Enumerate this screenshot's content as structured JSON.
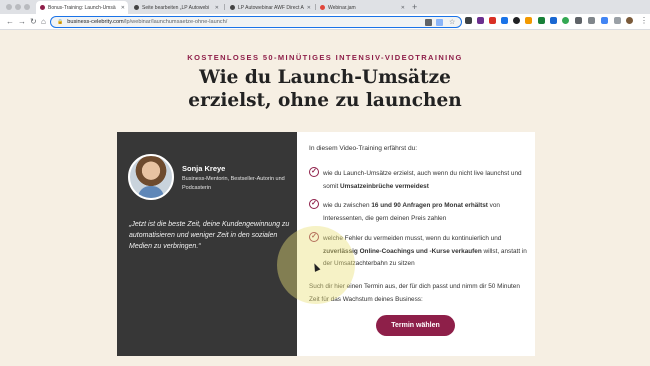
{
  "browser": {
    "tabs": [
      {
        "label": "Bonus-Training: Launch-Umsä",
        "active": true,
        "favicon_color": "#8e1f49"
      },
      {
        "label": "Seite bearbeiten „LP Autowebi",
        "active": false,
        "favicon_color": "#444444"
      },
      {
        "label": "LP Autowebinar AWF Direct A",
        "active": false,
        "favicon_color": "#444444"
      },
      {
        "label": "Webinar.jam",
        "active": false,
        "favicon_color": "#e0463a"
      }
    ],
    "new_tab_icon": "plus-icon",
    "url_host": "business-celebrity.com",
    "url_path": "/lp/webinar/launchumsaetze-ohne-launch/"
  },
  "page": {
    "kicker": "KOSTENLOSES 50-MINÜTIGES INTENSIV-VIDEOTRAINING",
    "title_line1": "Wie du Launch-Umsätze",
    "title_line2": "erzielst, ohne zu launchen",
    "speaker": {
      "name": "Sonja Kreye",
      "role": "Business-Mentorin, Bestseller-Autorin und Podcasterin",
      "quote": "„Jetzt ist die beste Zeit, deine Kundengewinnung zu automatisieren und weniger Zeit in den sozialen Medien zu verbringen.“"
    },
    "intro": "In diesem Video-Training erfährst du:",
    "bullets": [
      {
        "pre": "wie du Launch-Umsätze erzielst, auch wenn du nicht live launchst und somit ",
        "bold": "Umsatzeinbrüche vermeidest",
        "post": ""
      },
      {
        "pre": "wie du zwischen ",
        "bold": "16 und 90 Anfragen pro Monat erhältst",
        "post": " von Interessenten, die gern deinen Preis zahlen"
      },
      {
        "pre": "welche Fehler du vermeiden musst, wenn du kontinuierlich und ",
        "bold": "zuverlässig Online-Coachings und -Kurse verkaufen",
        "post": " willst, anstatt in der Umsatzachterbahn zu sitzen"
      }
    ],
    "cta_text": "Such dir hier einen Termin aus, der für dich passt und nimm dir 50 Minuten Zeit für das Wachstum deines Business:",
    "cta_button": "Termin wählen",
    "accent_color": "#8e1f49",
    "background_color": "#f6efe3"
  }
}
